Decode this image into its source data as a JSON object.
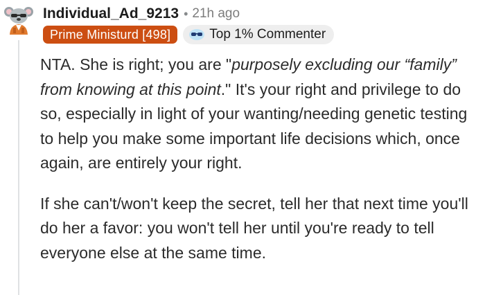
{
  "comment": {
    "username": "Individual_Ad_9213",
    "separator": "•",
    "timestamp": "21h ago",
    "user_flair": "Prime Ministurd [498]",
    "top_commenter_badge": "Top 1% Commenter",
    "paragraph1": {
      "part1": "NTA. She is right; you are \"",
      "quote_italic": "purposely excluding our “family” from knowing at this point",
      "part2": ".\" It's your right and privilege to do so, especially in light of your wanting/needing genetic testing to help you make some important life decisions which, once again, are entirely your right."
    },
    "paragraph2": "If she can't/won't keep the secret, tell her that next time you'll do her a favor: you won't tell her until you're ready to tell everyone else at the same time."
  },
  "colors": {
    "flair_bg": "#cc4e12",
    "badge_bg": "#eeeeee",
    "thread_line": "#dfe1e3"
  },
  "icons": {
    "avatar": "snoo-avatar-koala",
    "badge": "sunglasses-icon"
  }
}
